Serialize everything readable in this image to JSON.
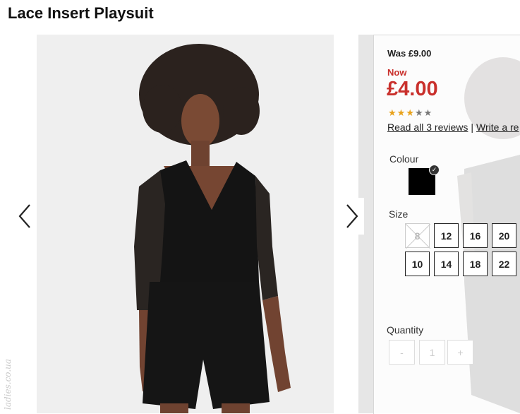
{
  "product": {
    "title": "Lace Insert Playsuit"
  },
  "gallery": {
    "prev_label": "Previous image",
    "next_label": "Next image",
    "image_alt": "Model wearing black lace insert playsuit"
  },
  "pricing": {
    "was": "Was £9.00",
    "now_label": "Now",
    "price": "£4.00"
  },
  "rating": {
    "value": 3,
    "max": 5,
    "star_color": "#e8a21b"
  },
  "reviews": {
    "read_all": "Read all 3 reviews",
    "separator": "|",
    "write": "Write a re"
  },
  "colour": {
    "label": "Colour",
    "selected": "#000000"
  },
  "size": {
    "label": "Size",
    "options_row1": [
      "8",
      "12",
      "16",
      "20"
    ],
    "options_row2": [
      "10",
      "14",
      "18",
      "22"
    ],
    "unavailable": [
      "8"
    ]
  },
  "quantity": {
    "label": "Quantity",
    "minus": "-",
    "value": "1",
    "plus": "+"
  },
  "watermark": "ladies.co.ua"
}
